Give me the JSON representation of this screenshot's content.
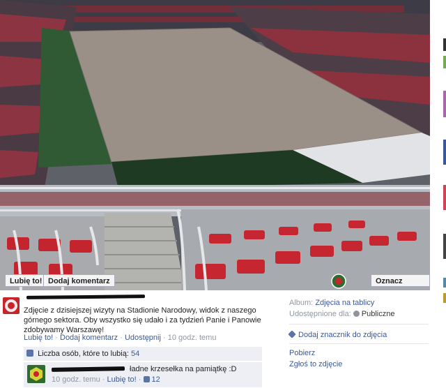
{
  "photo": {
    "like_button": "Lubię to!",
    "comment_button": "Dodaj komentarz",
    "tag_button": "Oznacz zdjęcie"
  },
  "post": {
    "text": "Zdjęcie z dzisiejszej wizyty na Stadionie Narodowy, widok z naszego górnego sektora. Oby wszystko się udało i za tydzień Panie i Panowie zdobywamy Warszawę!",
    "like_link": "Lubię to!",
    "comment_link": "Dodaj komentarz",
    "share_link": "Udostępnij",
    "time": "10 godz. temu",
    "sep": "·"
  },
  "likes": {
    "label": "Liczba osób, które to lubią:",
    "count": "54"
  },
  "comment": {
    "text": "ładne krzesełka na pamiątkę :D",
    "time": "10 godz. temu",
    "like_link": "Lubię to!",
    "like_count": "12",
    "sep": "·"
  },
  "sidebar": {
    "album_label": "Album:",
    "album_value": "Zdjęcia na tablicy",
    "shared_label": "Udostępnione dla:",
    "shared_value": "Publiczne",
    "tag_location": "Dodaj znacznik do zdjęcia",
    "download": "Pobierz",
    "report": "Zgłoś to zdjęcie"
  },
  "colors": {
    "link": "#3b5998",
    "muted": "#9197a3",
    "box_bg": "#edeff4"
  }
}
